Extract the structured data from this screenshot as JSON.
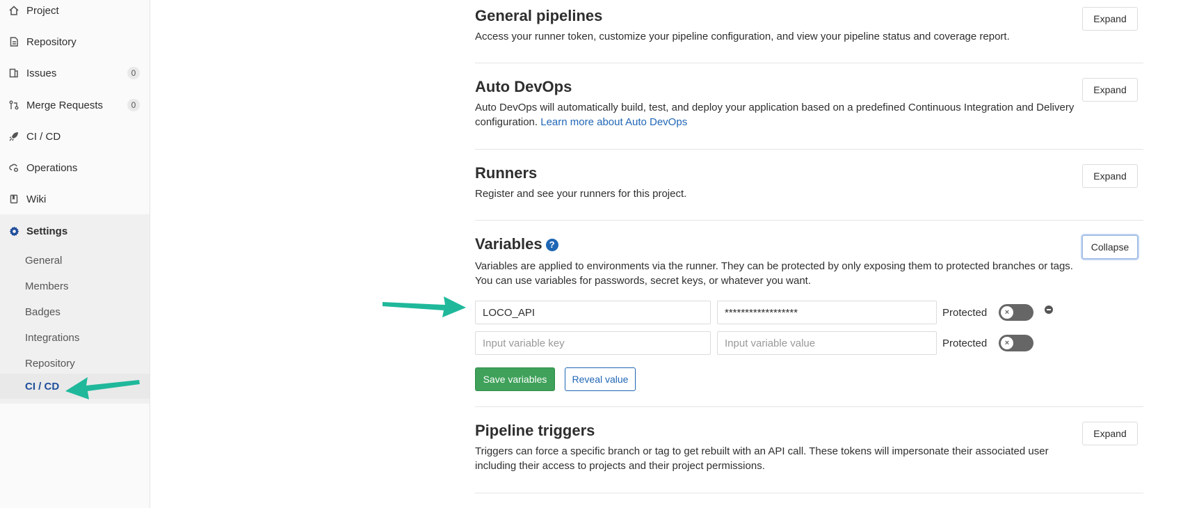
{
  "sidebar": {
    "items": [
      {
        "label": "Project",
        "icon": "home-icon"
      },
      {
        "label": "Repository",
        "icon": "file-icon"
      },
      {
        "label": "Issues",
        "icon": "issues-icon",
        "count": "0"
      },
      {
        "label": "Merge Requests",
        "icon": "merge-request-icon",
        "count": "0"
      },
      {
        "label": "CI / CD",
        "icon": "rocket-icon"
      },
      {
        "label": "Operations",
        "icon": "cloud-gear-icon"
      },
      {
        "label": "Wiki",
        "icon": "book-icon"
      },
      {
        "label": "Settings",
        "icon": "gear-icon"
      }
    ],
    "settings_sub": [
      "General",
      "Members",
      "Badges",
      "Integrations",
      "Repository",
      "CI / CD"
    ],
    "active_sub": "CI / CD"
  },
  "sections": {
    "general_pipelines": {
      "title": "General pipelines",
      "desc": "Access your runner token, customize your pipeline configuration, and view your pipeline status and coverage report.",
      "button": "Expand"
    },
    "auto_devops": {
      "title": "Auto DevOps",
      "desc": "Auto DevOps will automatically build, test, and deploy your application based on a predefined Continuous Integration and Delivery configuration.",
      "link": "Learn more about Auto DevOps",
      "button": "Expand"
    },
    "runners": {
      "title": "Runners",
      "desc": "Register and see your runners for this project.",
      "button": "Expand"
    },
    "variables": {
      "title": "Variables",
      "help": "?",
      "desc_line1": "Variables are applied to environments via the runner. They can be protected by only exposing them to protected branches or tags.",
      "desc_line2": "You can use variables for passwords, secret keys, or whatever you want.",
      "button": "Collapse",
      "rows": [
        {
          "key": "LOCO_API",
          "value": "******************",
          "protected_label": "Protected"
        },
        {
          "key_placeholder": "Input variable key",
          "value_placeholder": "Input variable value",
          "protected_label": "Protected"
        }
      ],
      "save_label": "Save variables",
      "reveal_label": "Reveal value"
    },
    "pipeline_triggers": {
      "title": "Pipeline triggers",
      "desc": "Triggers can force a specific branch or tag to get rebuilt with an API call. These tokens will impersonate their associated user including their access to projects and their project permissions.",
      "button": "Expand"
    }
  },
  "colors": {
    "accent_link": "#1f66b5",
    "save_green": "#3fa15a",
    "annotation_arrow": "#1fb89b"
  }
}
